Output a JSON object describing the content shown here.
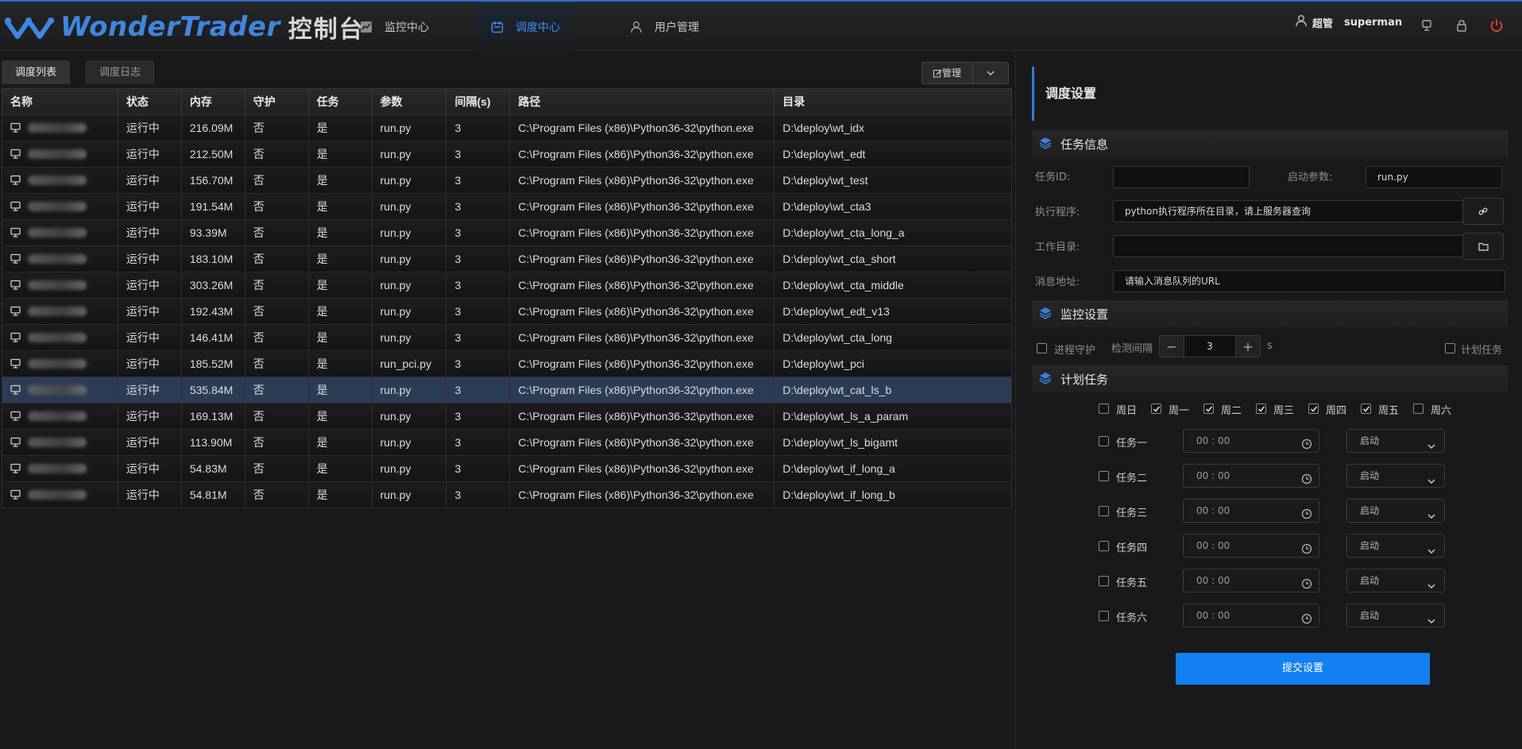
{
  "app": {
    "logo_text": "WonderTrader",
    "logo_sub": "控制台",
    "nav": [
      {
        "label": "监控中心",
        "icon": "chart-icon"
      },
      {
        "label": "调度中心",
        "icon": "calendar-icon"
      },
      {
        "label": "用户管理",
        "icon": "user-icon"
      }
    ],
    "active_nav": "调度中心",
    "user": {
      "name": "超管",
      "id": "superman"
    },
    "header_icons": [
      "monitor-icon",
      "lock-icon",
      "power-icon"
    ],
    "accent_color": "#2d6fd3"
  },
  "left": {
    "tabs": [
      "调度列表",
      "调度日志"
    ],
    "manage_label": "管理",
    "columns": [
      "名称",
      "状态",
      "内存",
      "守护",
      "任务",
      "参数",
      "间隔(s)",
      "路径",
      "目录"
    ],
    "rows": [
      {
        "status": "运行中",
        "memory": "216.09M",
        "guard": "否",
        "task": "是",
        "param": "run.py",
        "interval": "3",
        "path": "C:\\Program Files (x86)\\Python36-32\\python.exe",
        "dir": "D:\\deploy\\wt_idx"
      },
      {
        "status": "运行中",
        "memory": "212.50M",
        "guard": "否",
        "task": "是",
        "param": "run.py",
        "interval": "3",
        "path": "C:\\Program Files (x86)\\Python36-32\\python.exe",
        "dir": "D:\\deploy\\wt_edt"
      },
      {
        "status": "运行中",
        "memory": "156.70M",
        "guard": "否",
        "task": "是",
        "param": "run.py",
        "interval": "3",
        "path": "C:\\Program Files (x86)\\Python36-32\\python.exe",
        "dir": "D:\\deploy\\wt_test"
      },
      {
        "status": "运行中",
        "memory": "191.54M",
        "guard": "否",
        "task": "是",
        "param": "run.py",
        "interval": "3",
        "path": "C:\\Program Files (x86)\\Python36-32\\python.exe",
        "dir": "D:\\deploy\\wt_cta3"
      },
      {
        "status": "运行中",
        "memory": "93.39M",
        "guard": "否",
        "task": "是",
        "param": "run.py",
        "interval": "3",
        "path": "C:\\Program Files (x86)\\Python36-32\\python.exe",
        "dir": "D:\\deploy\\wt_cta_long_a"
      },
      {
        "status": "运行中",
        "memory": "183.10M",
        "guard": "否",
        "task": "是",
        "param": "run.py",
        "interval": "3",
        "path": "C:\\Program Files (x86)\\Python36-32\\python.exe",
        "dir": "D:\\deploy\\wt_cta_short"
      },
      {
        "status": "运行中",
        "memory": "303.26M",
        "guard": "否",
        "task": "是",
        "param": "run.py",
        "interval": "3",
        "path": "C:\\Program Files (x86)\\Python36-32\\python.exe",
        "dir": "D:\\deploy\\wt_cta_middle"
      },
      {
        "status": "运行中",
        "memory": "192.43M",
        "guard": "否",
        "task": "是",
        "param": "run.py",
        "interval": "3",
        "path": "C:\\Program Files (x86)\\Python36-32\\python.exe",
        "dir": "D:\\deploy\\wt_edt_v13"
      },
      {
        "status": "运行中",
        "memory": "146.41M",
        "guard": "否",
        "task": "是",
        "param": "run.py",
        "interval": "3",
        "path": "C:\\Program Files (x86)\\Python36-32\\python.exe",
        "dir": "D:\\deploy\\wt_cta_long"
      },
      {
        "status": "运行中",
        "memory": "185.52M",
        "guard": "否",
        "task": "是",
        "param": "run_pci.py",
        "interval": "3",
        "path": "C:\\Program Files (x86)\\Python36-32\\python.exe",
        "dir": "D:\\deploy\\wt_pci"
      },
      {
        "status": "运行中",
        "memory": "535.84M",
        "guard": "否",
        "task": "是",
        "param": "run.py",
        "interval": "3",
        "path": "C:\\Program Files (x86)\\Python36-32\\python.exe",
        "dir": "D:\\deploy\\wt_cat_ls_b",
        "selected": true
      },
      {
        "status": "运行中",
        "memory": "169.13M",
        "guard": "否",
        "task": "是",
        "param": "run.py",
        "interval": "3",
        "path": "C:\\Program Files (x86)\\Python36-32\\python.exe",
        "dir": "D:\\deploy\\wt_ls_a_param"
      },
      {
        "status": "运行中",
        "memory": "113.90M",
        "guard": "否",
        "task": "是",
        "param": "run.py",
        "interval": "3",
        "path": "C:\\Program Files (x86)\\Python36-32\\python.exe",
        "dir": "D:\\deploy\\wt_ls_bigamt"
      },
      {
        "status": "运行中",
        "memory": "54.83M",
        "guard": "否",
        "task": "是",
        "param": "run.py",
        "interval": "3",
        "path": "C:\\Program Files (x86)\\Python36-32\\python.exe",
        "dir": "D:\\deploy\\wt_if_long_a"
      },
      {
        "status": "运行中",
        "memory": "54.81M",
        "guard": "否",
        "task": "是",
        "param": "run.py",
        "interval": "3",
        "path": "C:\\Program Files (x86)\\Python36-32\\python.exe",
        "dir": "D:\\deploy\\wt_if_long_b"
      }
    ],
    "status_colors": {
      "running": "#18c46c",
      "no": "#e8422c",
      "param": "#f08d2c",
      "interval": "#1fc3d8",
      "selected_row": "#2b3c57"
    }
  },
  "right": {
    "title": "调度设置",
    "task_info": {
      "section": "任务信息",
      "task_id_label": "任务ID:",
      "task_id_value": "",
      "start_param_label": "启动参数:",
      "start_param_value": "run.py",
      "exec_label": "执行程序:",
      "exec_value": "python执行程序所在目录，请上服务器查询",
      "workdir_label": "工作目录:",
      "workdir_value": "",
      "msg_label": "消息地址:",
      "msg_value": "请输入消息队列的URL"
    },
    "monitor": {
      "section": "监控设置",
      "guard_label": "进程守护",
      "guard_checked": false,
      "interval_label": "检测间隔",
      "interval_value": "3",
      "interval_unit": "s",
      "schedule_label": "计划任务",
      "schedule_checked": false
    },
    "schedule": {
      "section": "计划任务",
      "days": [
        {
          "label": "周日",
          "checked": false
        },
        {
          "label": "周一",
          "checked": true
        },
        {
          "label": "周二",
          "checked": true
        },
        {
          "label": "周三",
          "checked": true
        },
        {
          "label": "周四",
          "checked": true
        },
        {
          "label": "周五",
          "checked": true
        },
        {
          "label": "周六",
          "checked": false
        }
      ],
      "tasks": [
        {
          "label": "任务一",
          "time": "00 : 00",
          "action": "启动"
        },
        {
          "label": "任务二",
          "time": "00 : 00",
          "action": "启动"
        },
        {
          "label": "任务三",
          "time": "00 : 00",
          "action": "启动"
        },
        {
          "label": "任务四",
          "time": "00 : 00",
          "action": "启动"
        },
        {
          "label": "任务五",
          "time": "00 : 00",
          "action": "启动"
        },
        {
          "label": "任务六",
          "time": "00 : 00",
          "action": "启动"
        }
      ]
    },
    "submit_label": "提交设置",
    "submit_color": "#1280f0"
  }
}
